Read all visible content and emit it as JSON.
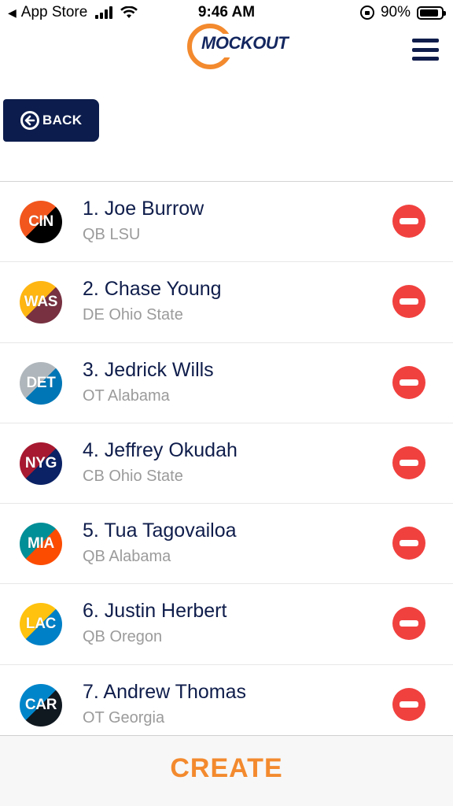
{
  "status_bar": {
    "back_app": "App Store",
    "time": "9:46 AM",
    "battery": "90%",
    "battery_level": 0.9
  },
  "header": {
    "logo_text": "MOCKOUT",
    "menu_icon": "hamburger-menu-icon"
  },
  "back_button": {
    "label": "BACK",
    "icon": "arrow-left-circle-icon"
  },
  "picks": [
    {
      "name": "1. Joe Burrow",
      "info": "QB LSU",
      "team": "CIN",
      "colors": [
        "#f2561d",
        "#000000"
      ]
    },
    {
      "name": "2. Chase Young",
      "info": "DE Ohio State",
      "team": "WAS",
      "colors": [
        "#ffb612",
        "#773141"
      ]
    },
    {
      "name": "3. Jedrick Wills",
      "info": "OT Alabama",
      "team": "DET",
      "colors": [
        "#b0b7bc",
        "#0076b6"
      ]
    },
    {
      "name": "4. Jeffrey Okudah",
      "info": "CB Ohio State",
      "team": "NYG",
      "colors": [
        "#a71930",
        "#0b2265"
      ]
    },
    {
      "name": "5. Tua Tagovailoa",
      "info": "QB Alabama",
      "team": "MIA",
      "colors": [
        "#008e97",
        "#fc4c02"
      ]
    },
    {
      "name": "6. Justin Herbert",
      "info": "QB Oregon",
      "team": "LAC",
      "colors": [
        "#ffc20e",
        "#0080c6"
      ]
    },
    {
      "name": "7. Andrew Thomas",
      "info": "OT Georgia",
      "team": "CAR",
      "colors": [
        "#0085ca",
        "#101820"
      ]
    }
  ],
  "remove_icon": "minus-circle-icon",
  "footer": {
    "create_label": "CREATE"
  },
  "colors": {
    "navy": "#0c1c4c",
    "orange": "#f38a2e",
    "remove_red": "#f0413f"
  }
}
